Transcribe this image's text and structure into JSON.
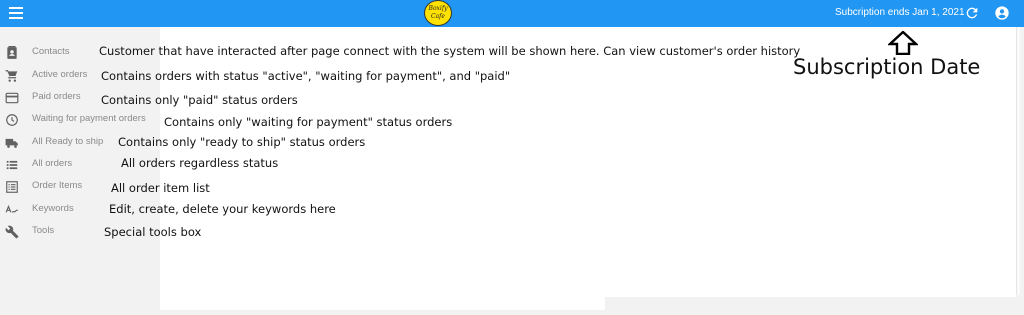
{
  "topbar": {
    "logo_line1": "Boxify",
    "logo_line2": "Cafe",
    "subscription_text": "Subcription ends Jan 1, 2021"
  },
  "sidebar": {
    "items": [
      {
        "label": "Contacts",
        "icon": "contacts-icon"
      },
      {
        "label": "Active orders",
        "icon": "cart-icon"
      },
      {
        "label": "Paid orders",
        "icon": "credit-card-icon"
      },
      {
        "label": "Waiting for payment orders",
        "icon": "clock-icon"
      },
      {
        "label": "All Ready to ship",
        "icon": "truck-icon"
      },
      {
        "label": "All orders",
        "icon": "list-icon"
      },
      {
        "label": "Order Items",
        "icon": "order-items-icon"
      },
      {
        "label": "Keywords",
        "icon": "keywords-icon"
      },
      {
        "label": "Tools",
        "icon": "wrench-icon"
      }
    ]
  },
  "annotations": [
    "Customer that have interacted after page connect with the system will be shown here. Can view customer's order history",
    "Contains orders with status \"active\", \"waiting for payment\", and \"paid\"",
    "Contains only \"paid\" status orders",
    "Contains only \"waiting for payment\" status orders",
    "Contains only \"ready to ship\" status orders",
    "All orders regardless status",
    "All order item list",
    "Edit, create, delete your keywords here",
    "Special tools  box"
  ],
  "subscription_callout": "Subscription Date",
  "colors": {
    "topbar": "#2196f3",
    "logo": "#ffe200",
    "sidebar_text": "#8a8a8a",
    "sidebar_icon": "#616161"
  }
}
